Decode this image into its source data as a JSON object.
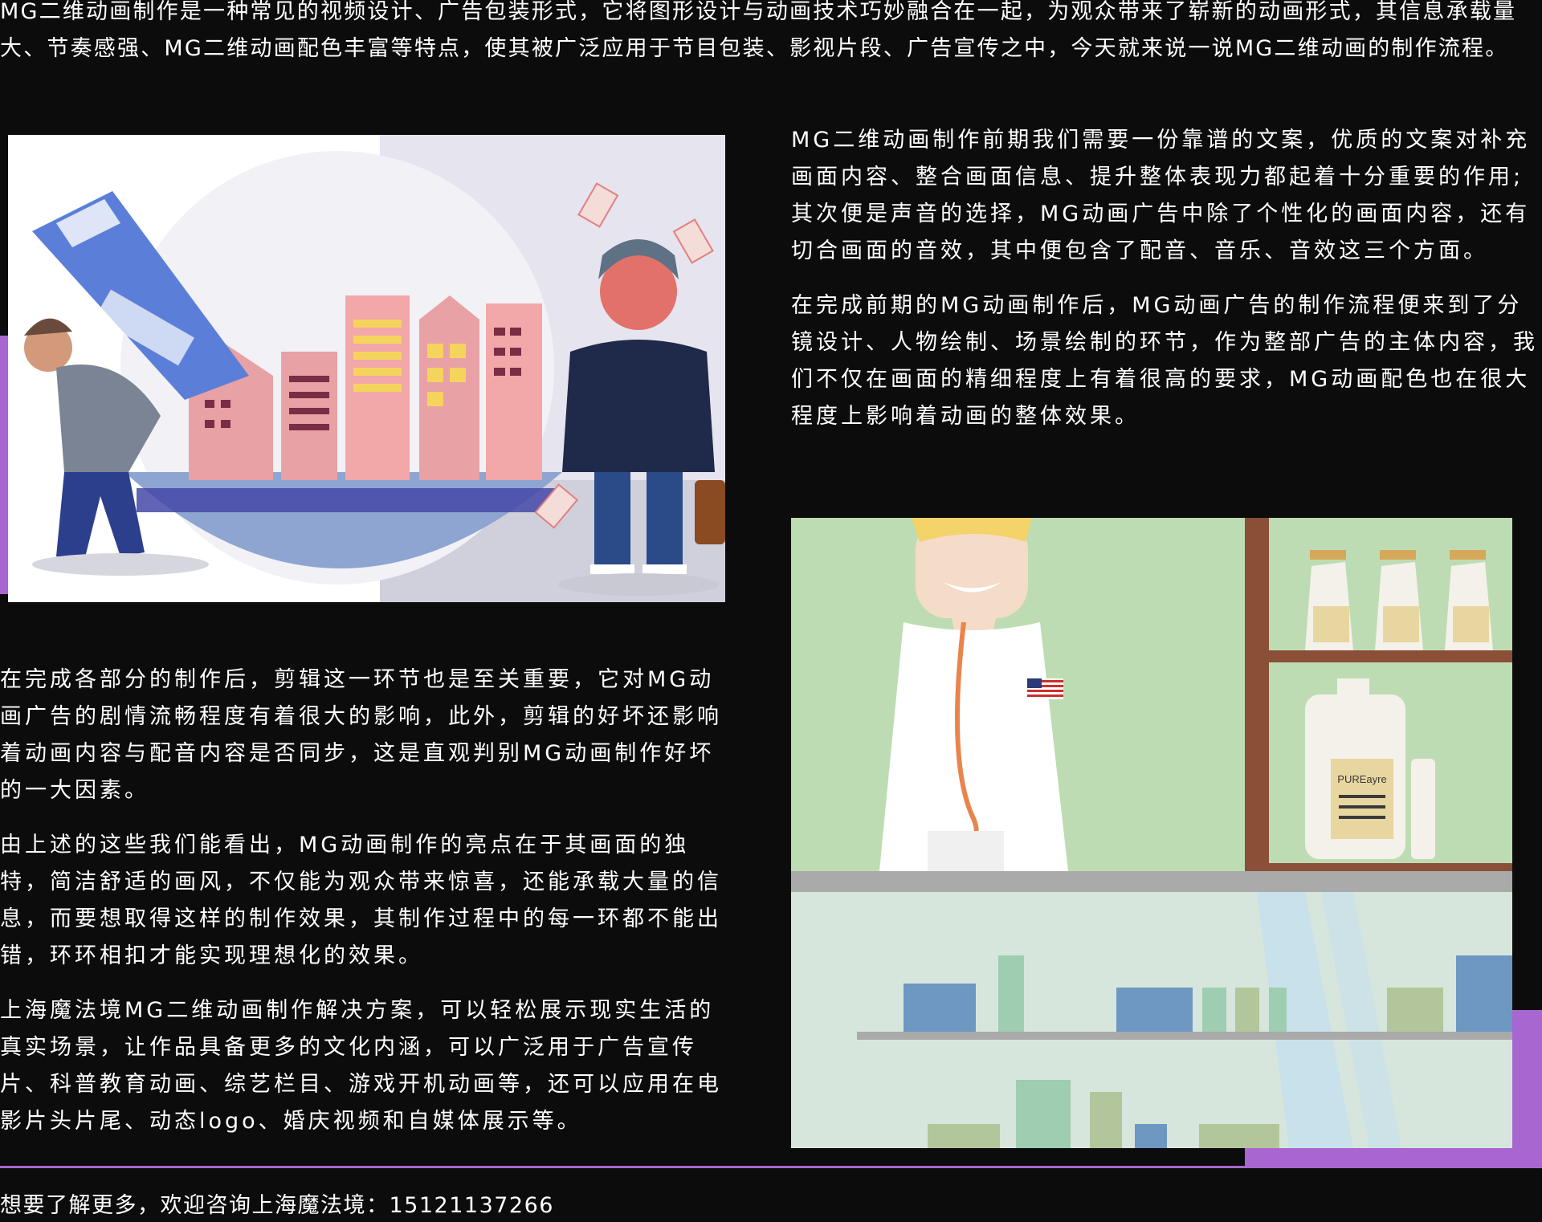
{
  "article": {
    "intro": "MG二维动画制作是一种常见的视频设计、广告包装形式，它将图形设计与动画技术巧妙融合在一起，为观众带来了崭新的动画形式，其信息承载量大、节奏感强、MG二维动画配色丰富等特点，使其被广泛应用于节目包装、影视片段、广告宣传之中，今天就来说一说MG二维动画的制作流程。",
    "paragraphs": [
      "MG二维动画制作前期我们需要一份靠谱的文案，优质的文案对补充画面内容、整合画面信息、提升整体表现力都起着十分重要的作用;其次便是声音的选择，MG动画广告中除了个性化的画面内容，还有切合画面的音效，其中便包含了配音、音乐、音效这三个方面。",
      "在完成前期的MG动画制作后，MG动画广告的制作流程便来到了分镜设计、人物绘制、场景绘制的环节，作为整部广告的主体内容，我们不仅在画面的精细程度上有着很高的要求，MG动画配色也在很大程度上影响着动画的整体效果。",
      "在完成各部分的制作后，剪辑这一环节也是至关重要，它对MG动画广告的剧情流畅程度有着很大的影响，此外，剪辑的好坏还影响着动画内容与配音内容是否同步，这是直观判别MG动画制作好坏的一大因素。",
      "由上述的这些我们能看出，MG动画制作的亮点在于其画面的独特，简洁舒适的画风，不仅能为观众带来惊喜，还能承载大量的信息，而要想取得这样的制作效果，其制作过程中的每一环都不能出错，环环相扣才能实现理想化的效果。",
      "上海魔法境MG二维动画制作解决方案，可以轻松展示现实生活的真实场景，让作品具备更多的文化内涵，可以广泛用于广告宣传片、科普教育动画、综艺栏目、游戏开机动画等，还可以应用在电影片头片尾、动态logo、婚庆视频和自媒体展示等。"
    ],
    "footer": "想要了解更多，欢迎咨询上海魔法境：15121137266"
  },
  "illustrations": {
    "city_scene": {
      "subject": "city-scene-illustration"
    },
    "pharmacy_scene": {
      "subject": "pharmacy-scene-illustration",
      "bottle_label": "PUREayre"
    }
  },
  "colors": {
    "background": "#0c0c0d",
    "text": "#ffffff",
    "accent": "#a866d0"
  }
}
